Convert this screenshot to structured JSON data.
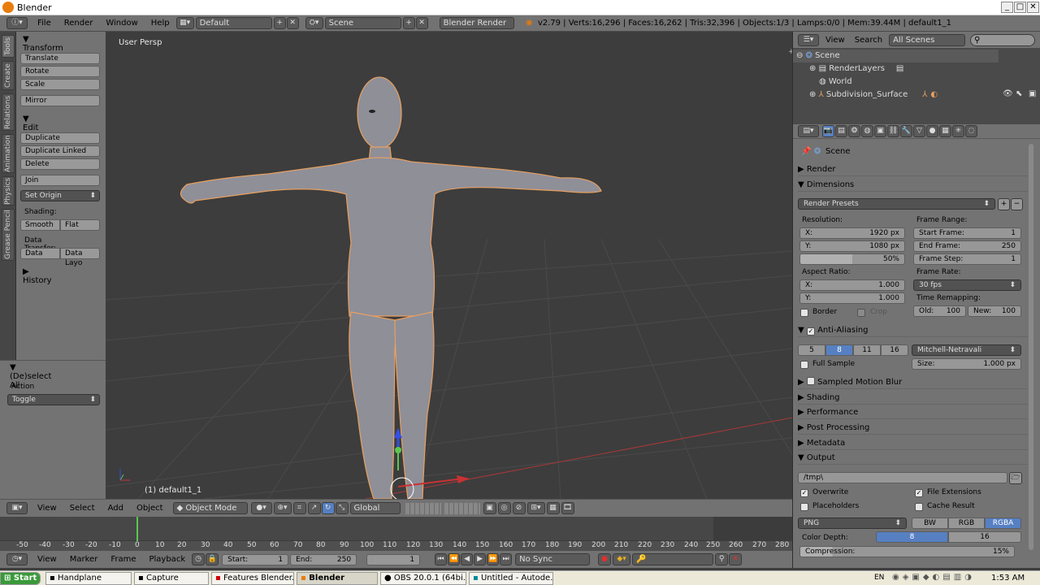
{
  "window": {
    "title": "Blender"
  },
  "info_header": {
    "menus": [
      "File",
      "Render",
      "Window",
      "Help"
    ],
    "layout": "Default",
    "scene": "Scene",
    "engine": "Blender Render",
    "stats": "v2.79 | Verts:16,296 | Faces:16,262 | Tris:32,396 | Objects:1/3 | Lamps:0/0 | Mem:39.44M | default1_1"
  },
  "tabs": [
    "Tools",
    "Create",
    "Relations",
    "Animation",
    "Physics",
    "Grease Pencil"
  ],
  "tool_shelf": {
    "transform_header": "Transform",
    "translate": "Translate",
    "rotate": "Rotate",
    "scale": "Scale",
    "mirror": "Mirror",
    "edit_header": "Edit",
    "duplicate": "Duplicate",
    "duplicate_linked": "Duplicate Linked",
    "delete": "Delete",
    "join": "Join",
    "set_origin": "Set Origin",
    "shading_label": "Shading:",
    "smooth": "Smooth",
    "flat": "Flat",
    "data_transfer_label": "Data Transfer:",
    "data": "Data",
    "data_layout": "Data Layo",
    "history_header": "History",
    "operator_header": "(De)select All",
    "action_label": "Action",
    "action_value": "Toggle"
  },
  "viewport": {
    "view_name": "User Persp",
    "object_label": "(1) default1_1"
  },
  "view_header": {
    "menus": [
      "View",
      "Select",
      "Add",
      "Object"
    ],
    "mode": "Object Mode",
    "orientation": "Global"
  },
  "timeline": {
    "ticks": [
      "-50",
      "-40",
      "-30",
      "-20",
      "-10",
      "0",
      "10",
      "20",
      "30",
      "40",
      "50",
      "60",
      "70",
      "80",
      "90",
      "100",
      "110",
      "120",
      "130",
      "140",
      "150",
      "160",
      "170",
      "180",
      "190",
      "200",
      "210",
      "220",
      "230",
      "240",
      "250",
      "260",
      "270",
      "280"
    ],
    "menus": [
      "View",
      "Marker",
      "Frame",
      "Playback"
    ],
    "start": "Start:",
    "start_value": "1",
    "end": "End:",
    "end_value": "250",
    "current": "1",
    "sync": "No Sync"
  },
  "outliner": {
    "menus": [
      "View",
      "Search"
    ],
    "filter": "All Scenes",
    "rows": [
      "Scene",
      "RenderLayers",
      "World",
      "Subdivision_Surface"
    ]
  },
  "properties": {
    "context": "Scene",
    "render": "Render",
    "dimensions": "Dimensions",
    "render_presets": "Render Presets",
    "resolution_label": "Resolution:",
    "res_x_label": "X:",
    "res_x": "1920 px",
    "res_y_label": "Y:",
    "res_y": "1080 px",
    "res_pct": "50%",
    "frame_range_label": "Frame Range:",
    "start_frame_label": "Start Frame:",
    "start_frame": "1",
    "end_frame_label": "End Frame:",
    "end_frame": "250",
    "frame_step_label": "Frame Step:",
    "frame_step": "1",
    "aspect_label": "Aspect Ratio:",
    "asp_x_label": "X:",
    "asp_x": "1.000",
    "asp_y_label": "Y:",
    "asp_y": "1.000",
    "frame_rate_label": "Frame Rate:",
    "frame_rate": "30 fps",
    "time_remap_label": "Time Remapping:",
    "old_label": "Old:",
    "old_value": "100",
    "new_label": "New:",
    "new_value": "100",
    "border": "Border",
    "crop": "Crop",
    "anti_aliasing": "Anti-Aliasing",
    "aa_samples": [
      "5",
      "8",
      "11",
      "16"
    ],
    "aa_filter": "Mitchell-Netravali",
    "full_sample": "Full Sample",
    "size_label": "Size:",
    "size_value": "1.000 px",
    "sampled_motion_blur": "Sampled Motion Blur",
    "shading": "Shading",
    "performance": "Performance",
    "post_processing": "Post Processing",
    "metadata": "Metadata",
    "output": "Output",
    "output_path": "/tmp\\",
    "overwrite": "Overwrite",
    "file_extensions": "File Extensions",
    "placeholders": "Placeholders",
    "cache_result": "Cache Result",
    "file_format": "PNG",
    "color_modes": [
      "BW",
      "RGB",
      "RGBA"
    ],
    "color_depth_label": "Color Depth:",
    "depth_options": [
      "8",
      "16"
    ],
    "compression_label": "Compression:",
    "compression_value": "15%"
  },
  "taskbar": {
    "start": "Start",
    "tasks": [
      "Handplane",
      "Capture",
      "Features Blender...",
      "Blender",
      "OBS 20.0.1 (64bi...",
      "Untitled - Autode..."
    ],
    "lang": "EN",
    "clock": "1:53 AM"
  },
  "colors": {
    "accent": "#5680c2",
    "selection_outline": "#e8a060",
    "axis_red": "#c83232",
    "axis_green": "#5ac850",
    "axis_blue": "#3250e6"
  }
}
